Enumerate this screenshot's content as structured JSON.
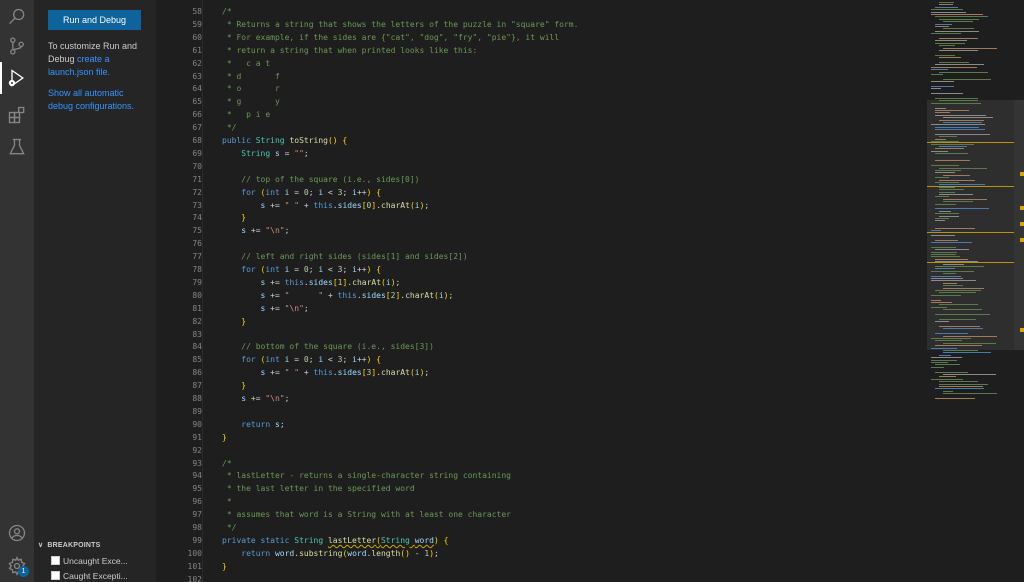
{
  "activity_bar": {
    "icons": [
      "search-icon",
      "source-control-icon",
      "run-debug-icon",
      "extensions-icon",
      "testing-icon",
      "account-icon",
      "settings-gear-icon"
    ],
    "settings_badge": "1"
  },
  "sidebar": {
    "run_button_label": "Run and Debug",
    "customize_text": "To customize Run and Debug ",
    "customize_link": "create a launch.json file.",
    "show_all_link": "Show all automatic debug configurations.",
    "breakpoints": {
      "header": "BREAKPOINTS",
      "items": [
        {
          "label": "Uncaught Exce..."
        },
        {
          "label": "Caught Excepti..."
        }
      ]
    }
  },
  "editor": {
    "line_numbers": [
      "58",
      "59",
      "60",
      "61",
      "62",
      "63",
      "64",
      "65",
      "66",
      "67",
      "68",
      "69",
      "70",
      "71",
      "72",
      "73",
      "74",
      "75",
      "76",
      "77",
      "78",
      "79",
      "80",
      "81",
      "82",
      "83",
      "84",
      "85",
      "86",
      "87",
      "88",
      "89",
      "90",
      "91",
      "92",
      "93",
      "94",
      "95",
      "96",
      "97",
      "98",
      "99",
      "100",
      "101",
      "102"
    ],
    "lines": [
      [
        [
          "cm",
          "/*"
        ]
      ],
      [
        [
          "cm",
          " * Returns a string that shows the letters of the puzzle in \"square\" form."
        ]
      ],
      [
        [
          "cm",
          " * For example, if the sides are {\"cat\", \"dog\", \"fry\", \"pie\"}, it will"
        ]
      ],
      [
        [
          "cm",
          " * return a string that when printed looks like this:"
        ]
      ],
      [
        [
          "cm",
          " *   c a t"
        ]
      ],
      [
        [
          "cm",
          " * d       f"
        ]
      ],
      [
        [
          "cm",
          " * o       r"
        ]
      ],
      [
        [
          "cm",
          " * g       y"
        ]
      ],
      [
        [
          "cm",
          " *   p i e"
        ]
      ],
      [
        [
          "cm",
          " */"
        ]
      ],
      [
        [
          "kw",
          "public "
        ],
        [
          "ty",
          "String "
        ],
        [
          "fn",
          "toString"
        ],
        [
          "bk",
          "() {"
        ]
      ],
      [
        [
          "pn",
          "    "
        ],
        [
          "ty",
          "String "
        ],
        [
          "vr",
          "s"
        ],
        [
          "pn",
          " = "
        ],
        [
          "st",
          "\"\""
        ],
        [
          "pn",
          ";"
        ]
      ],
      [
        [
          "pn",
          ""
        ]
      ],
      [
        [
          "pn",
          "    "
        ],
        [
          "cm",
          "// top of the square (i.e., sides[0])"
        ]
      ],
      [
        [
          "pn",
          "    "
        ],
        [
          "kw",
          "for "
        ],
        [
          "bk",
          "("
        ],
        [
          "kw",
          "int "
        ],
        [
          "vr",
          "i"
        ],
        [
          "pn",
          " = "
        ],
        [
          "nm",
          "0"
        ],
        [
          "pn",
          "; "
        ],
        [
          "vr",
          "i"
        ],
        [
          "pn",
          " < "
        ],
        [
          "nm",
          "3"
        ],
        [
          "pn",
          "; "
        ],
        [
          "vr",
          "i"
        ],
        [
          "pn",
          "++"
        ],
        [
          "bk",
          ") {"
        ]
      ],
      [
        [
          "pn",
          "        "
        ],
        [
          "vr",
          "s"
        ],
        [
          "pn",
          " += "
        ],
        [
          "st",
          "\" \""
        ],
        [
          "pn",
          " + "
        ],
        [
          "kw",
          "this"
        ],
        [
          "pn",
          "."
        ],
        [
          "vr",
          "sides"
        ],
        [
          "bk",
          "["
        ],
        [
          "nm",
          "0"
        ],
        [
          "bk",
          "]"
        ],
        [
          "pn",
          "."
        ],
        [
          "fn",
          "charAt"
        ],
        [
          "bk",
          "("
        ],
        [
          "vr",
          "i"
        ],
        [
          "bk",
          ")"
        ],
        [
          "pn",
          ";"
        ]
      ],
      [
        [
          "pn",
          "    "
        ],
        [
          "bk",
          "}"
        ]
      ],
      [
        [
          "pn",
          "    "
        ],
        [
          "vr",
          "s"
        ],
        [
          "pn",
          " += "
        ],
        [
          "st",
          "\"\\n\""
        ],
        [
          "pn",
          ";"
        ]
      ],
      [
        [
          "pn",
          ""
        ]
      ],
      [
        [
          "pn",
          "    "
        ],
        [
          "cm",
          "// left and right sides (sides[1] and sides[2])"
        ]
      ],
      [
        [
          "pn",
          "    "
        ],
        [
          "kw",
          "for "
        ],
        [
          "bk",
          "("
        ],
        [
          "kw",
          "int "
        ],
        [
          "vr",
          "i"
        ],
        [
          "pn",
          " = "
        ],
        [
          "nm",
          "0"
        ],
        [
          "pn",
          "; "
        ],
        [
          "vr",
          "i"
        ],
        [
          "pn",
          " < "
        ],
        [
          "nm",
          "3"
        ],
        [
          "pn",
          "; "
        ],
        [
          "vr",
          "i"
        ],
        [
          "pn",
          "++"
        ],
        [
          "bk",
          ") {"
        ]
      ],
      [
        [
          "pn",
          "        "
        ],
        [
          "vr",
          "s"
        ],
        [
          "pn",
          " += "
        ],
        [
          "kw",
          "this"
        ],
        [
          "pn",
          "."
        ],
        [
          "vr",
          "sides"
        ],
        [
          "bk",
          "["
        ],
        [
          "nm",
          "1"
        ],
        [
          "bk",
          "]"
        ],
        [
          "pn",
          "."
        ],
        [
          "fn",
          "charAt"
        ],
        [
          "bk",
          "("
        ],
        [
          "vr",
          "i"
        ],
        [
          "bk",
          ")"
        ],
        [
          "pn",
          ";"
        ]
      ],
      [
        [
          "pn",
          "        "
        ],
        [
          "vr",
          "s"
        ],
        [
          "pn",
          " += "
        ],
        [
          "st",
          "\"      \""
        ],
        [
          "pn",
          " + "
        ],
        [
          "kw",
          "this"
        ],
        [
          "pn",
          "."
        ],
        [
          "vr",
          "sides"
        ],
        [
          "bk",
          "["
        ],
        [
          "nm",
          "2"
        ],
        [
          "bk",
          "]"
        ],
        [
          "pn",
          "."
        ],
        [
          "fn",
          "charAt"
        ],
        [
          "bk",
          "("
        ],
        [
          "vr",
          "i"
        ],
        [
          "bk",
          ")"
        ],
        [
          "pn",
          ";"
        ]
      ],
      [
        [
          "pn",
          "        "
        ],
        [
          "vr",
          "s"
        ],
        [
          "pn",
          " += "
        ],
        [
          "st",
          "\"\\n\""
        ],
        [
          "pn",
          ";"
        ]
      ],
      [
        [
          "pn",
          "    "
        ],
        [
          "bk",
          "}"
        ]
      ],
      [
        [
          "pn",
          ""
        ]
      ],
      [
        [
          "pn",
          "    "
        ],
        [
          "cm",
          "// bottom of the square (i.e., sides[3])"
        ]
      ],
      [
        [
          "pn",
          "    "
        ],
        [
          "kw",
          "for "
        ],
        [
          "bk",
          "("
        ],
        [
          "kw",
          "int "
        ],
        [
          "vr",
          "i"
        ],
        [
          "pn",
          " = "
        ],
        [
          "nm",
          "0"
        ],
        [
          "pn",
          "; "
        ],
        [
          "vr",
          "i"
        ],
        [
          "pn",
          " < "
        ],
        [
          "nm",
          "3"
        ],
        [
          "pn",
          "; "
        ],
        [
          "vr",
          "i"
        ],
        [
          "pn",
          "++"
        ],
        [
          "bk",
          ") {"
        ]
      ],
      [
        [
          "pn",
          "        "
        ],
        [
          "vr",
          "s"
        ],
        [
          "pn",
          " += "
        ],
        [
          "st",
          "\" \""
        ],
        [
          "pn",
          " + "
        ],
        [
          "kw",
          "this"
        ],
        [
          "pn",
          "."
        ],
        [
          "vr",
          "sides"
        ],
        [
          "bk",
          "["
        ],
        [
          "nm",
          "3"
        ],
        [
          "bk",
          "]"
        ],
        [
          "pn",
          "."
        ],
        [
          "fn",
          "charAt"
        ],
        [
          "bk",
          "("
        ],
        [
          "vr",
          "i"
        ],
        [
          "bk",
          ")"
        ],
        [
          "pn",
          ";"
        ]
      ],
      [
        [
          "pn",
          "    "
        ],
        [
          "bk",
          "}"
        ]
      ],
      [
        [
          "pn",
          "    "
        ],
        [
          "vr",
          "s"
        ],
        [
          "pn",
          " += "
        ],
        [
          "st",
          "\"\\n\""
        ],
        [
          "pn",
          ";"
        ]
      ],
      [
        [
          "pn",
          ""
        ]
      ],
      [
        [
          "pn",
          "    "
        ],
        [
          "kw",
          "return "
        ],
        [
          "vr",
          "s"
        ],
        [
          "pn",
          ";"
        ]
      ],
      [
        [
          "bk",
          "}"
        ]
      ],
      [
        [
          "pn",
          ""
        ]
      ],
      [
        [
          "cm",
          "/*"
        ]
      ],
      [
        [
          "cm",
          " * lastLetter - returns a single-character string containing"
        ]
      ],
      [
        [
          "cm",
          " * the last letter in the specified word"
        ]
      ],
      [
        [
          "cm",
          " *"
        ]
      ],
      [
        [
          "cm",
          " * assumes that word is a String with at least one character"
        ]
      ],
      [
        [
          "cm",
          " */"
        ]
      ],
      [
        [
          "kw",
          "private static "
        ],
        [
          "ty",
          "String "
        ],
        [
          "fn",
          "lastLetter"
        ],
        [
          "bk",
          "("
        ],
        [
          "ty",
          "String "
        ],
        [
          "vr",
          "word"
        ],
        [
          "bk",
          ") {"
        ]
      ],
      [
        [
          "pn",
          "    "
        ],
        [
          "kw",
          "return "
        ],
        [
          "vr",
          "word"
        ],
        [
          "pn",
          "."
        ],
        [
          "fn",
          "substring"
        ],
        [
          "bk",
          "("
        ],
        [
          "vr",
          "word"
        ],
        [
          "pn",
          "."
        ],
        [
          "fn",
          "length"
        ],
        [
          "bk",
          "()"
        ],
        [
          "pn",
          " - "
        ],
        [
          "nm",
          "1"
        ],
        [
          "bk",
          ")"
        ],
        [
          "pn",
          ";"
        ]
      ],
      [
        [
          "bk",
          "}"
        ]
      ],
      [
        [
          "pn",
          ""
        ]
      ]
    ]
  },
  "colors": {
    "accent": "#0e639c",
    "link": "#3794ff",
    "editor_bg": "#1e1e1e",
    "sidebar_bg": "#252526",
    "activity_bg": "#333333",
    "badge": "#0e639c"
  }
}
